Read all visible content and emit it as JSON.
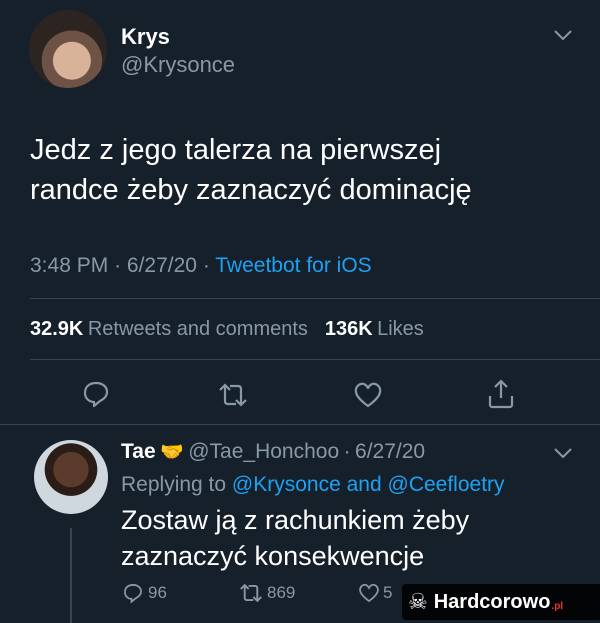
{
  "tweet": {
    "display_name": "Krys",
    "handle": "@Krysonce",
    "text_line1": "Jedz z jego talerza na pierwszej",
    "text_line2": "randce żeby zaznaczyć dominację",
    "time": "3:48 PM",
    "date": "6/27/20",
    "client": "Tweetbot for iOS",
    "retweets_count": "32.9K",
    "retweets_label": "Retweets and comments",
    "likes_count": "136K",
    "likes_label": "Likes"
  },
  "reply": {
    "display_name": "Tae",
    "handle": "@Tae_Honchoo",
    "date": "6/27/20",
    "replying_prefix": "Replying to",
    "replying_to_1": "@Krysonce",
    "replying_and": "and",
    "replying_to_2": "@Ceefloetry",
    "text_line1": "Zostaw ją z rachunkiem żeby",
    "text_line2": "zaznaczyć konsekwencje",
    "comments": "96",
    "retweets": "869",
    "likes": "5"
  },
  "watermark": {
    "text": "Hardcorowo",
    "suffix": ".pl"
  },
  "icons": [
    "chevron-down-icon",
    "comment-icon",
    "retweet-icon",
    "like-icon",
    "share-icon",
    "handshake-emoji",
    "skull-icon"
  ]
}
